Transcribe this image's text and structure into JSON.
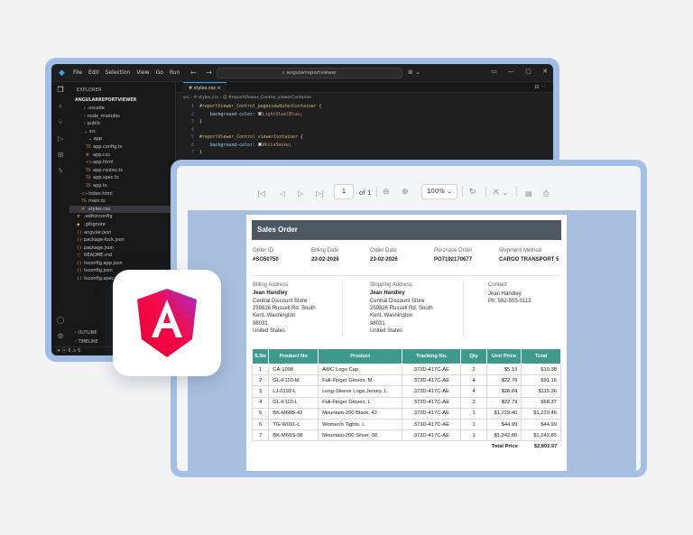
{
  "vscode": {
    "menu": [
      "File",
      "Edit",
      "Selection",
      "View",
      "Go",
      "Run"
    ],
    "nav_back": "←",
    "nav_forward": "→",
    "search_placeholder": "angularreportviewer",
    "sidebar": {
      "title": "EXPLORER",
      "root": "ANGULARREPORTVIEWER",
      "items": [
        {
          "label": "› .vscode",
          "depth": 0,
          "icon": ""
        },
        {
          "label": "› node_modules",
          "depth": 0,
          "icon": ""
        },
        {
          "label": "› public",
          "depth": 0,
          "icon": ""
        },
        {
          "label": "⌄ src",
          "depth": 0,
          "icon": ""
        },
        {
          "label": "⌄ app",
          "depth": 1,
          "icon": ""
        },
        {
          "label": "app.config.ts",
          "depth": 2,
          "icon": "TS"
        },
        {
          "label": "app.css",
          "depth": 2,
          "icon": "#"
        },
        {
          "label": "app.html",
          "depth": 2,
          "icon": "<>"
        },
        {
          "label": "app.routes.ts",
          "depth": 2,
          "icon": "TS"
        },
        {
          "label": "app.spec.ts",
          "depth": 2,
          "icon": "TS"
        },
        {
          "label": "app.ts",
          "depth": 2,
          "icon": "TS"
        },
        {
          "label": "index.html",
          "depth": 1,
          "icon": "<>"
        },
        {
          "label": "main.ts",
          "depth": 1,
          "icon": "TS"
        },
        {
          "label": "styles.css",
          "depth": 1,
          "icon": "#"
        },
        {
          "label": ".editorconfig",
          "depth": 0,
          "icon": "⚙"
        },
        {
          "label": ".gitignore",
          "depth": 0,
          "icon": "◆"
        },
        {
          "label": "angular.json",
          "depth": 0,
          "icon": "{}"
        },
        {
          "label": "package-lock.json",
          "depth": 0,
          "icon": "{}"
        },
        {
          "label": "package.json",
          "depth": 0,
          "icon": "{}"
        },
        {
          "label": "README.md",
          "depth": 0,
          "icon": "ⓘ"
        },
        {
          "label": "tsconfig.app.json",
          "depth": 0,
          "icon": "{}"
        },
        {
          "label": "tsconfig.json",
          "depth": 0,
          "icon": "{}"
        },
        {
          "label": "tsconfig.spec.json",
          "depth": 0,
          "icon": "{}"
        }
      ],
      "selected_index": 13,
      "outline": "› OUTLINE",
      "timeline": "› TIMELINE"
    },
    "editor": {
      "tab": "# styles.css ×",
      "breadcrumb": "src › # styles.css › 😊 #reportViewer_Control_viewerContainer",
      "lines": [
        {
          "n": "1",
          "sel": "#reportViewer_Control_pageviewOuterContainer",
          "open": " {"
        },
        {
          "n": "2",
          "prop": "background-color",
          "swatch": "#b0c4de",
          "value": "LightSteelBlue"
        },
        {
          "n": "3",
          "close": "}"
        },
        {
          "n": "4"
        },
        {
          "n": "5",
          "sel": "#reportViewer_Control_viewerContainer",
          "open": " {"
        },
        {
          "n": "6",
          "prop": "background-color",
          "swatch": "#f5f5f5",
          "value": "WhiteSmoke"
        },
        {
          "n": "7",
          "close": "}"
        }
      ]
    },
    "status": "✕ ⓧ 0 ⚠ 0"
  },
  "viewer": {
    "toolbar": {
      "first": "|◁",
      "prev": "◁",
      "next": "▷",
      "last": "▷|",
      "page_current": "1",
      "page_of": "of 1",
      "zoom": "100%  ⌄"
    },
    "report": {
      "title": "Sales Order",
      "meta": [
        {
          "label": "Order ID",
          "value": "#SO50750"
        },
        {
          "label": "Billing Date",
          "value": "23-02-2026"
        },
        {
          "label": "Order Date",
          "value": "23-02-2026"
        },
        {
          "label": "Purchase Order",
          "value": "PO7192170677"
        },
        {
          "label": "Shipment Method",
          "value": "CARGO TRANSPORT 5"
        }
      ],
      "billing": {
        "label": "Billing Address",
        "name": "Jean Handley",
        "lines": [
          "Central Discount Store",
          "259826 Russell Rd. South",
          "Kent, Washington",
          "98031",
          "United States"
        ]
      },
      "shipping": {
        "label": "Shipping Address",
        "name": "Jean Handley",
        "lines": [
          "Central Discount Store",
          "259826 Russell Rd. South",
          "Kent, Washington",
          "98031",
          "United States"
        ]
      },
      "contact": {
        "label": "Contact",
        "lines": [
          "Jean Handley",
          "Ph: 582-555-0113"
        ]
      },
      "columns": [
        "S.No",
        "Product No",
        "Product",
        "Tracking No.",
        "Qty",
        "Unit Price",
        "Total"
      ],
      "rows": [
        [
          "1",
          "CA-1098",
          "AWC Logo Cap",
          "373D-417C-AE",
          "2",
          "$5.19",
          "$10.38"
        ],
        [
          "2",
          "GL-F110-M",
          "Full-Finger Gloves, M",
          "373D-417C-AE",
          "4",
          "$22.79",
          "$91.16"
        ],
        [
          "3",
          "LJ-0192-L",
          "Long-Sleeve Logo Jersey, L",
          "373D-417C-AE",
          "4",
          "$28.84",
          "$115.36"
        ],
        [
          "4",
          "GL-F110-L",
          "Full-Finger Gloves, L",
          "373D-417C-AE",
          "3",
          "$22.79",
          "$68.37"
        ],
        [
          "5",
          "BK-M68B-42",
          "Mountain-200 Black, 42",
          "373D-417C-AE",
          "1",
          "$1,229.46",
          "$1,229.46"
        ],
        [
          "6",
          "TG-W091-L",
          "Women's Tights, L",
          "373D-417C-AE",
          "1",
          "$44.99",
          "$44.99"
        ],
        [
          "7",
          "BK-M68S-38",
          "Mountain-200 Silver, 38",
          "373D-417C-AE",
          "1",
          "$1,242.85",
          "$1,242.85"
        ]
      ],
      "total_label": "Total Price",
      "total_value": "$2,802.57"
    }
  },
  "colors": {
    "table_header": "#3d9a8d",
    "report_header": "#4d5760",
    "canvas_bg": "#a9bfde",
    "angular_pink": "#e40035",
    "angular_purple": "#9f2fd0"
  }
}
